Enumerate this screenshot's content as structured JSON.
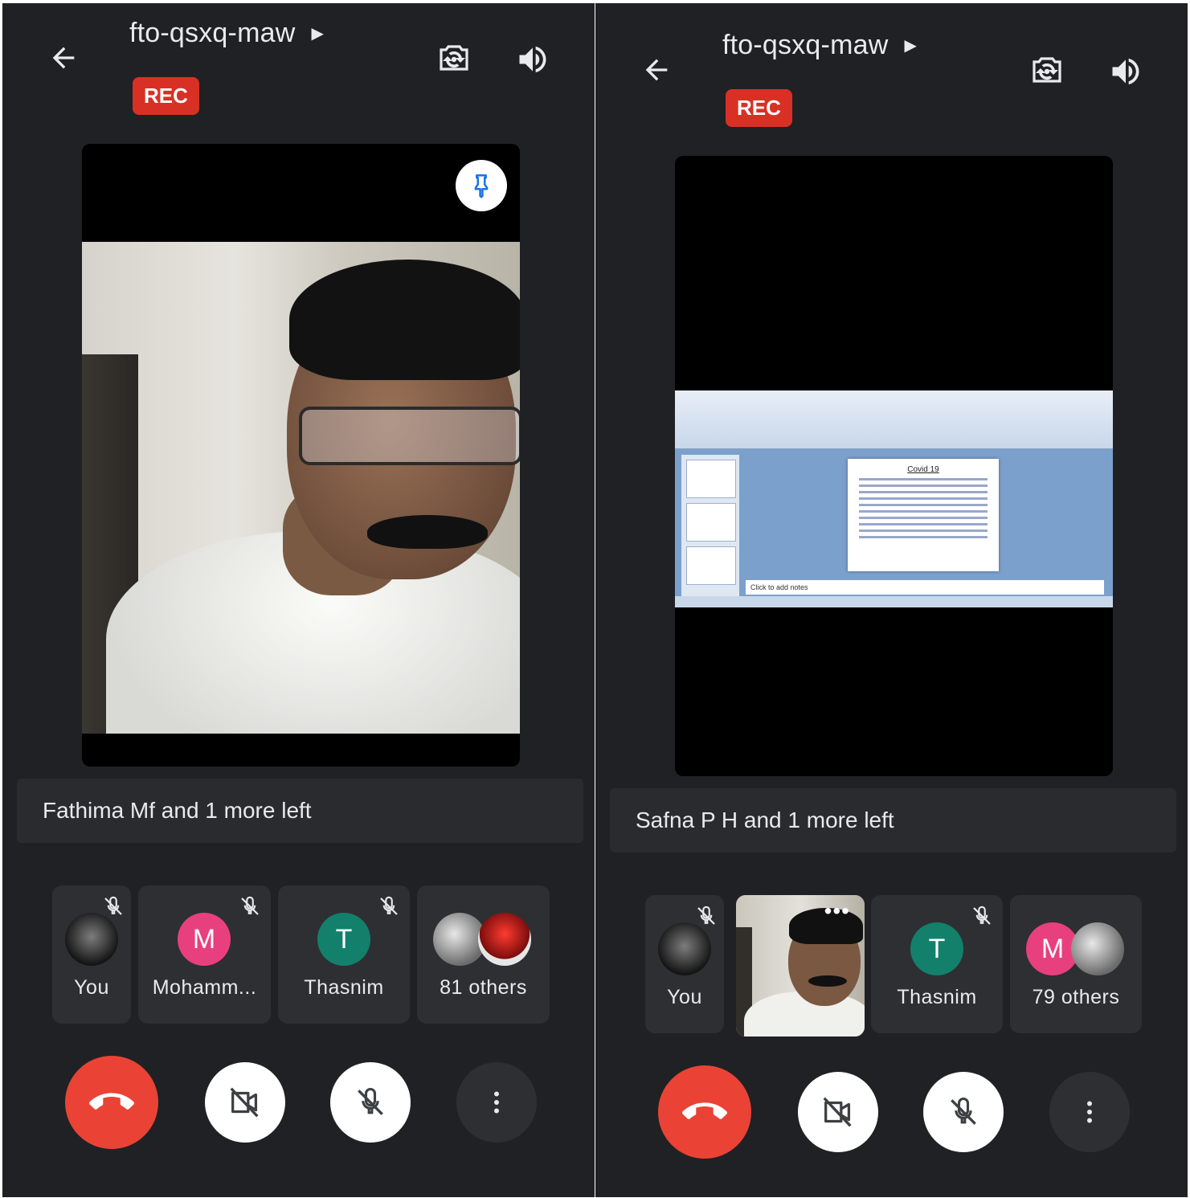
{
  "left": {
    "meeting_code": "fto-qsxq-maw",
    "rec": "REC",
    "notice": "Fathima Mf and 1 more left",
    "tiles": [
      {
        "label": "You"
      },
      {
        "label": "Mohamm...",
        "initial": "M"
      },
      {
        "label": "Thasnim",
        "initial": "T"
      },
      {
        "label": "81 others"
      }
    ]
  },
  "right": {
    "meeting_code": "fto-qsxq-maw",
    "rec": "REC",
    "notice": "Safna P H and 1 more left",
    "slide": {
      "title": "Covid 19",
      "notes": "Click to add notes"
    },
    "tiles": [
      {
        "label": "You"
      },
      {
        "more": "•••"
      },
      {
        "label": "Thasnim",
        "initial": "T"
      },
      {
        "label": "79 others",
        "initial": "M"
      }
    ]
  },
  "icons": [
    "back-arrow-icon",
    "chevron-right-icon",
    "camera-switch-icon",
    "speaker-icon",
    "pin-icon",
    "mic-off-icon",
    "call-end-icon",
    "videocam-off-icon",
    "more-vert-icon"
  ],
  "colors": {
    "background": "#202124",
    "rec": "#d93025",
    "end_call": "#ea4335",
    "avatar_m": "#e8407e",
    "avatar_t": "#12806b",
    "pin": "#1a73e8"
  }
}
